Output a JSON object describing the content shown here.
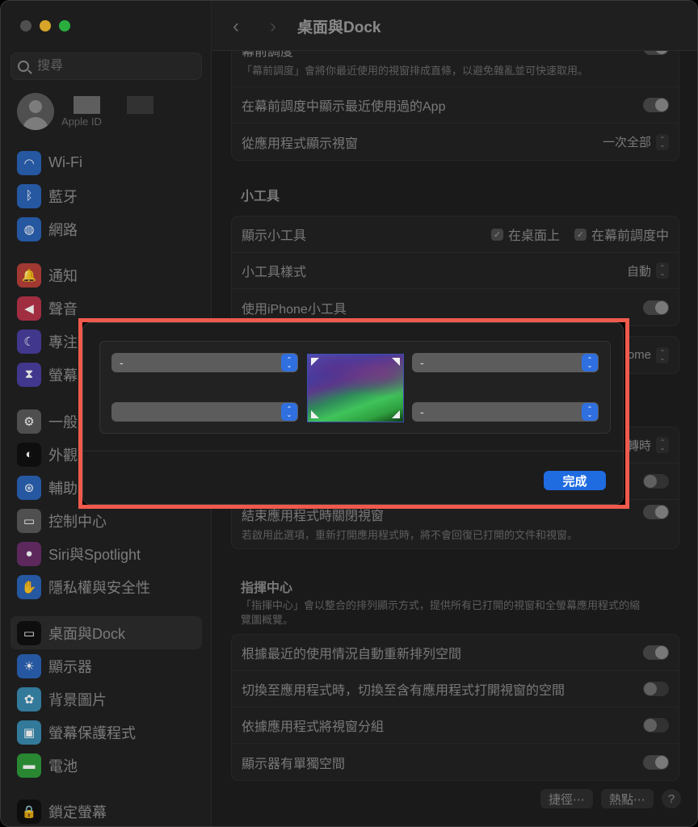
{
  "window": {
    "traffic_lights": {
      "close": "#5a5a5a",
      "minimize": "#f4bc2f",
      "zoom": "#30c748"
    }
  },
  "sidebar": {
    "search_placeholder": "搜尋",
    "profile": {
      "subtitle": "Apple ID"
    },
    "items": [
      {
        "label": "Wi-Fi",
        "icon": "wifi-icon",
        "glyph": "◠",
        "color": "#2c64b8"
      },
      {
        "label": "藍牙",
        "icon": "bluetooth-icon",
        "glyph": "ᛒ",
        "color": "#2c64b8"
      },
      {
        "label": "網路",
        "icon": "globe-icon",
        "glyph": "◍",
        "color": "#2c64b8"
      },
      {
        "label": "通知",
        "icon": "bell-icon",
        "glyph": "🔔",
        "color": "#b8403a"
      },
      {
        "label": "聲音",
        "icon": "speaker-icon",
        "glyph": "◀",
        "color": "#b8344a"
      },
      {
        "label": "專注",
        "icon": "moon-icon",
        "glyph": "☾",
        "color": "#4a3fa0"
      },
      {
        "label": "螢幕",
        "icon": "hourglass-icon",
        "glyph": "⧗",
        "color": "#4a3fa0"
      },
      {
        "label": "一般",
        "icon": "gear-icon",
        "glyph": "⚙",
        "color": "#5a5a5a"
      },
      {
        "label": "外觀",
        "icon": "appearance-icon",
        "glyph": "◐",
        "color": "#111111"
      },
      {
        "label": "輔助",
        "icon": "accessibility-icon",
        "glyph": "⊛",
        "color": "#2c64b8"
      },
      {
        "label": "控制中心",
        "icon": "control-center-icon",
        "glyph": "▭",
        "color": "#5a5a5a"
      },
      {
        "label": "Siri與Spotlight",
        "icon": "siri-icon",
        "glyph": "●",
        "color": "#6a2f6a"
      },
      {
        "label": "隱私權與安全性",
        "icon": "hand-icon",
        "glyph": "✋",
        "color": "#2c64b8"
      },
      {
        "label": "桌面與Dock",
        "icon": "desktop-dock-icon",
        "glyph": "▭",
        "color": "#111111",
        "active": true
      },
      {
        "label": "顯示器",
        "icon": "display-icon",
        "glyph": "☀",
        "color": "#2c64b8"
      },
      {
        "label": "背景圖片",
        "icon": "wallpaper-icon",
        "glyph": "✿",
        "color": "#3a8ab0"
      },
      {
        "label": "螢幕保護程式",
        "icon": "screensaver-icon",
        "glyph": "▣",
        "color": "#3a8ab0"
      },
      {
        "label": "電池",
        "icon": "battery-icon",
        "glyph": "▬",
        "color": "#2f9a3a"
      },
      {
        "label": "鎖定螢幕",
        "icon": "lock-icon",
        "glyph": "🔒",
        "color": "#111111"
      }
    ]
  },
  "main": {
    "title": "桌面與Dock",
    "stage_manager": {
      "label": "幕前調度",
      "desc": "「幕前調度」會將你最近使用的視窗排成直條，以避免雜亂並可快速取用。",
      "toggle_on": true
    },
    "show_recent_apps": {
      "label": "在幕前調度中顯示最近使用過的App",
      "toggle_on": true
    },
    "show_windows_from_app": {
      "label": "從應用程式顯示視窗",
      "value": "一次全部"
    },
    "widgets": {
      "title": "小工具",
      "show_widgets": {
        "label": "顯示小工具",
        "options": [
          {
            "label": "在桌面上",
            "checked": true
          },
          {
            "label": "在幕前調度中",
            "checked": true
          }
        ]
      },
      "widget_style": {
        "label": "小工具樣式",
        "value": "自動"
      },
      "iphone_widgets": {
        "label": "使用iPhone小工具",
        "toggle_on": true
      }
    },
    "browser_row": {
      "value_partial": "ome"
    },
    "hidden_group": {
      "popup_partial": "轉時",
      "toggle1_on": false,
      "close_windows": {
        "label": "結束應用程式時關閉視窗",
        "desc": "若啟用此選項，重新打開應用程式時，將不會回復已打開的文件和視窗。",
        "toggle_on": true
      }
    },
    "mission_control": {
      "title": "指揮中心",
      "desc": "「指揮中心」會以整合的排列顯示方式，提供所有已打開的視窗和全螢幕應用程式的縮覽圖概覽。",
      "rows": [
        {
          "label": "根據最近的使用情況自動重新排列空間",
          "toggle_on": true
        },
        {
          "label": "切換至應用程式時，切換至含有應用程式打開視窗的空間",
          "toggle_on": false
        },
        {
          "label": "依據應用程式將視窗分組",
          "toggle_on": false
        },
        {
          "label": "顯示器有單獨空間",
          "toggle_on": true
        }
      ]
    },
    "footer": {
      "shortcuts": "捷徑⋯",
      "hot_corners": "熱點⋯",
      "help": "?"
    }
  },
  "hot_corners_dialog": {
    "top_left": "-",
    "bottom_left": "",
    "top_right": "-",
    "bottom_right": "-",
    "done": "完成",
    "accent": "#1f6be0",
    "highlight": "#ef5a4c"
  }
}
